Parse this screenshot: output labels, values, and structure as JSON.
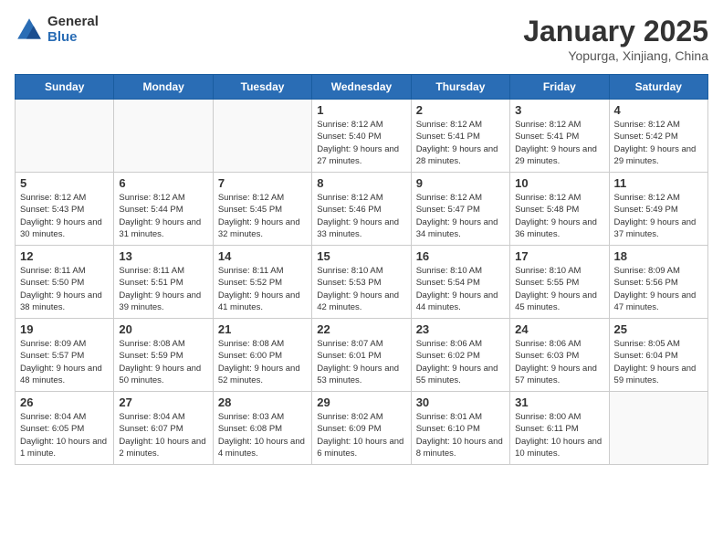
{
  "logo": {
    "general": "General",
    "blue": "Blue"
  },
  "header": {
    "title": "January 2025",
    "subtitle": "Yopurga, Xinjiang, China"
  },
  "days_of_week": [
    "Sunday",
    "Monday",
    "Tuesday",
    "Wednesday",
    "Thursday",
    "Friday",
    "Saturday"
  ],
  "weeks": [
    [
      {
        "day": "",
        "info": ""
      },
      {
        "day": "",
        "info": ""
      },
      {
        "day": "",
        "info": ""
      },
      {
        "day": "1",
        "info": "Sunrise: 8:12 AM\nSunset: 5:40 PM\nDaylight: 9 hours and 27 minutes."
      },
      {
        "day": "2",
        "info": "Sunrise: 8:12 AM\nSunset: 5:41 PM\nDaylight: 9 hours and 28 minutes."
      },
      {
        "day": "3",
        "info": "Sunrise: 8:12 AM\nSunset: 5:41 PM\nDaylight: 9 hours and 29 minutes."
      },
      {
        "day": "4",
        "info": "Sunrise: 8:12 AM\nSunset: 5:42 PM\nDaylight: 9 hours and 29 minutes."
      }
    ],
    [
      {
        "day": "5",
        "info": "Sunrise: 8:12 AM\nSunset: 5:43 PM\nDaylight: 9 hours and 30 minutes."
      },
      {
        "day": "6",
        "info": "Sunrise: 8:12 AM\nSunset: 5:44 PM\nDaylight: 9 hours and 31 minutes."
      },
      {
        "day": "7",
        "info": "Sunrise: 8:12 AM\nSunset: 5:45 PM\nDaylight: 9 hours and 32 minutes."
      },
      {
        "day": "8",
        "info": "Sunrise: 8:12 AM\nSunset: 5:46 PM\nDaylight: 9 hours and 33 minutes."
      },
      {
        "day": "9",
        "info": "Sunrise: 8:12 AM\nSunset: 5:47 PM\nDaylight: 9 hours and 34 minutes."
      },
      {
        "day": "10",
        "info": "Sunrise: 8:12 AM\nSunset: 5:48 PM\nDaylight: 9 hours and 36 minutes."
      },
      {
        "day": "11",
        "info": "Sunrise: 8:12 AM\nSunset: 5:49 PM\nDaylight: 9 hours and 37 minutes."
      }
    ],
    [
      {
        "day": "12",
        "info": "Sunrise: 8:11 AM\nSunset: 5:50 PM\nDaylight: 9 hours and 38 minutes."
      },
      {
        "day": "13",
        "info": "Sunrise: 8:11 AM\nSunset: 5:51 PM\nDaylight: 9 hours and 39 minutes."
      },
      {
        "day": "14",
        "info": "Sunrise: 8:11 AM\nSunset: 5:52 PM\nDaylight: 9 hours and 41 minutes."
      },
      {
        "day": "15",
        "info": "Sunrise: 8:10 AM\nSunset: 5:53 PM\nDaylight: 9 hours and 42 minutes."
      },
      {
        "day": "16",
        "info": "Sunrise: 8:10 AM\nSunset: 5:54 PM\nDaylight: 9 hours and 44 minutes."
      },
      {
        "day": "17",
        "info": "Sunrise: 8:10 AM\nSunset: 5:55 PM\nDaylight: 9 hours and 45 minutes."
      },
      {
        "day": "18",
        "info": "Sunrise: 8:09 AM\nSunset: 5:56 PM\nDaylight: 9 hours and 47 minutes."
      }
    ],
    [
      {
        "day": "19",
        "info": "Sunrise: 8:09 AM\nSunset: 5:57 PM\nDaylight: 9 hours and 48 minutes."
      },
      {
        "day": "20",
        "info": "Sunrise: 8:08 AM\nSunset: 5:59 PM\nDaylight: 9 hours and 50 minutes."
      },
      {
        "day": "21",
        "info": "Sunrise: 8:08 AM\nSunset: 6:00 PM\nDaylight: 9 hours and 52 minutes."
      },
      {
        "day": "22",
        "info": "Sunrise: 8:07 AM\nSunset: 6:01 PM\nDaylight: 9 hours and 53 minutes."
      },
      {
        "day": "23",
        "info": "Sunrise: 8:06 AM\nSunset: 6:02 PM\nDaylight: 9 hours and 55 minutes."
      },
      {
        "day": "24",
        "info": "Sunrise: 8:06 AM\nSunset: 6:03 PM\nDaylight: 9 hours and 57 minutes."
      },
      {
        "day": "25",
        "info": "Sunrise: 8:05 AM\nSunset: 6:04 PM\nDaylight: 9 hours and 59 minutes."
      }
    ],
    [
      {
        "day": "26",
        "info": "Sunrise: 8:04 AM\nSunset: 6:05 PM\nDaylight: 10 hours and 1 minute."
      },
      {
        "day": "27",
        "info": "Sunrise: 8:04 AM\nSunset: 6:07 PM\nDaylight: 10 hours and 2 minutes."
      },
      {
        "day": "28",
        "info": "Sunrise: 8:03 AM\nSunset: 6:08 PM\nDaylight: 10 hours and 4 minutes."
      },
      {
        "day": "29",
        "info": "Sunrise: 8:02 AM\nSunset: 6:09 PM\nDaylight: 10 hours and 6 minutes."
      },
      {
        "day": "30",
        "info": "Sunrise: 8:01 AM\nSunset: 6:10 PM\nDaylight: 10 hours and 8 minutes."
      },
      {
        "day": "31",
        "info": "Sunrise: 8:00 AM\nSunset: 6:11 PM\nDaylight: 10 hours and 10 minutes."
      },
      {
        "day": "",
        "info": ""
      }
    ]
  ]
}
